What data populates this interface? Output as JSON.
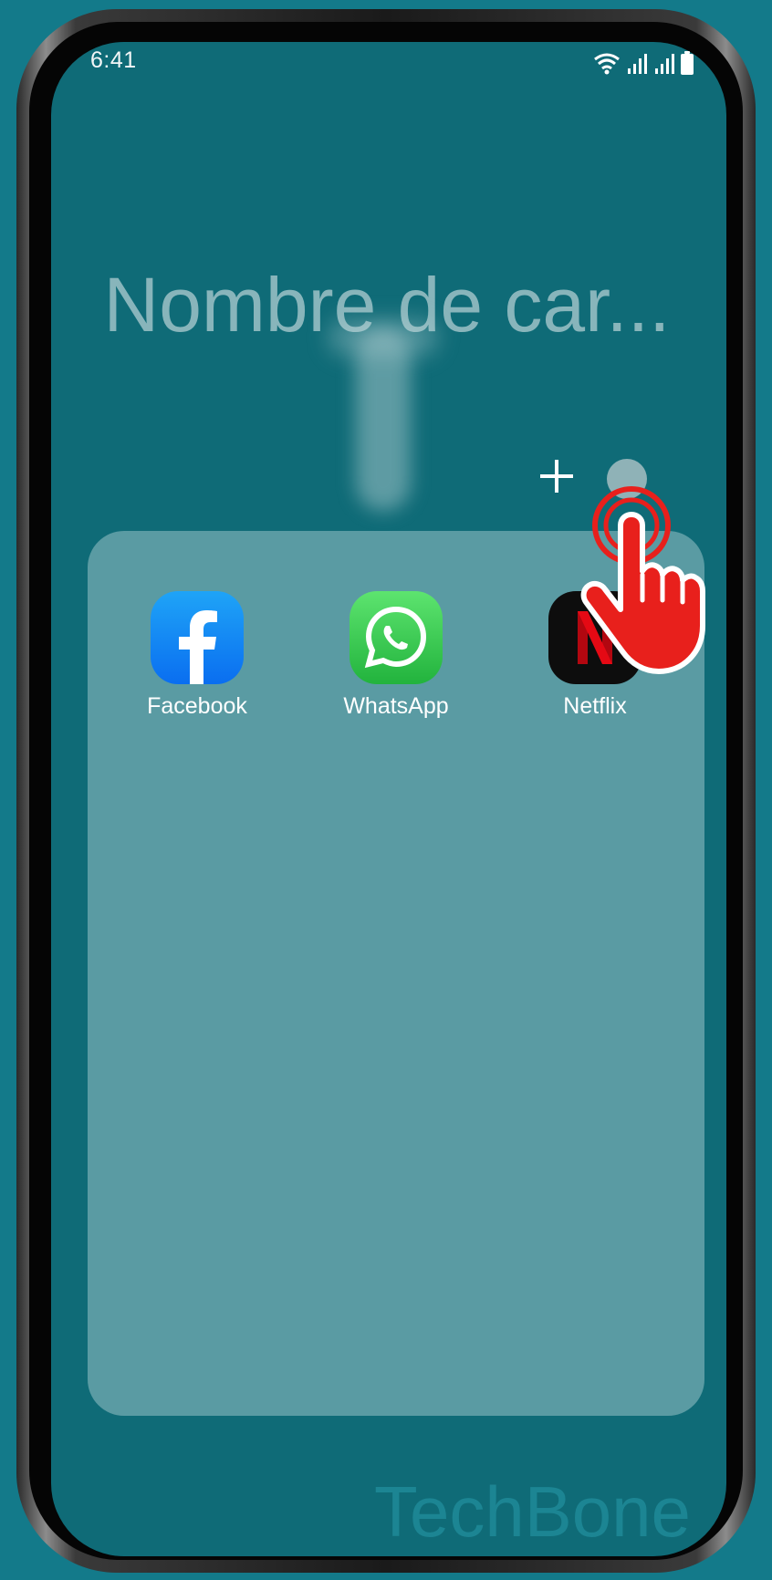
{
  "status_bar": {
    "time": "6:41"
  },
  "folder": {
    "title": "Nombre de car...",
    "add_icon": "plus-icon",
    "color_dot_color": "#8fb2b7"
  },
  "apps": [
    {
      "label": "Facebook",
      "icon": "facebook-icon"
    },
    {
      "label": "WhatsApp",
      "icon": "whatsapp-icon"
    },
    {
      "label": "Netflix",
      "icon": "netflix-icon"
    }
  ],
  "watermark": "TechBone",
  "colors": {
    "background": "#137a8a",
    "screen": "#0f6b77",
    "folder_panel": "#5a9ba3",
    "tap_indicator": "#e8201c"
  }
}
